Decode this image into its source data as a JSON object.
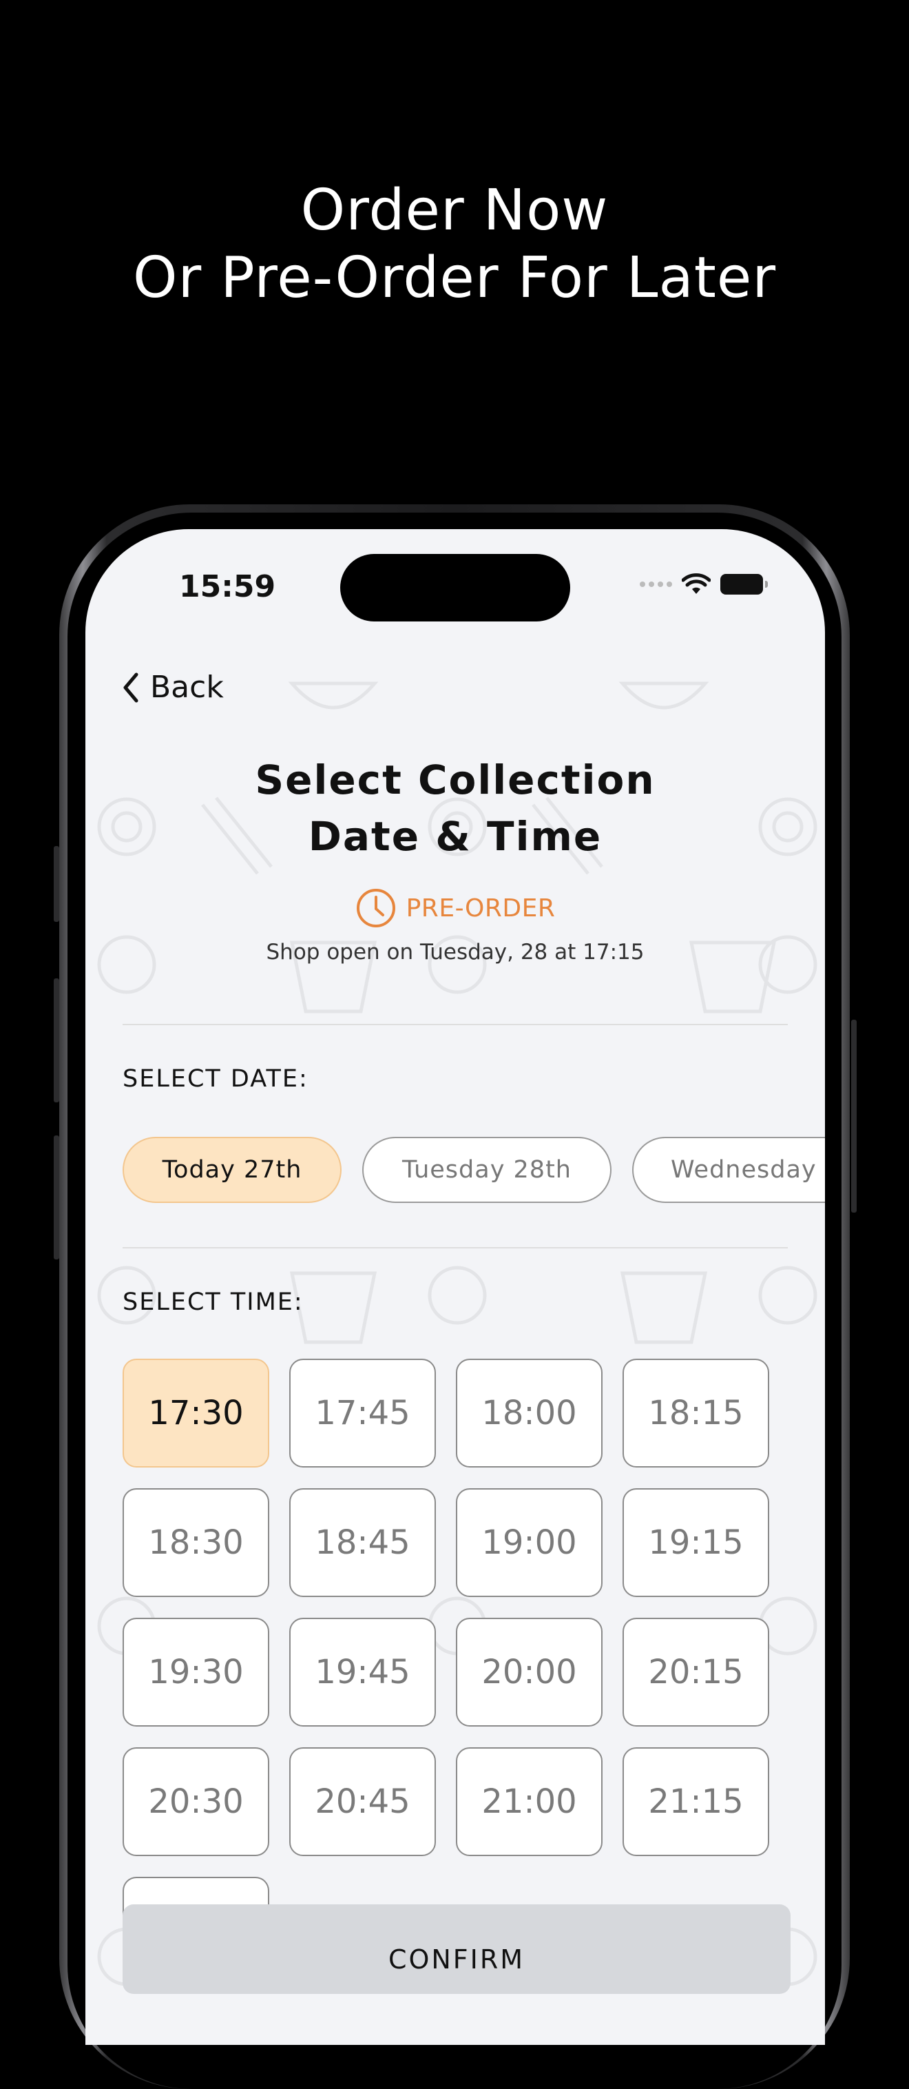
{
  "promo": {
    "line1": "Order Now",
    "line2": "Or Pre-Order For Later"
  },
  "status_bar": {
    "time": "15:59"
  },
  "nav": {
    "back_label": "Back"
  },
  "header": {
    "title_line1": "Select Collection",
    "title_line2": "Date & Time",
    "badge": "PRE-ORDER",
    "shop_open_text": "Shop open on Tuesday, 28 at 17:15"
  },
  "date_section": {
    "label": "SELECT DATE:",
    "options": [
      "Today 27th",
      "Tuesday 28th",
      "Wednesday"
    ],
    "selected": "Today 27th"
  },
  "time_section": {
    "label": "SELECT TIME:",
    "slots": [
      "17:30",
      "17:45",
      "18:00",
      "18:15",
      "18:30",
      "18:45",
      "19:00",
      "19:15",
      "19:30",
      "19:45",
      "20:00",
      "20:15",
      "20:30",
      "20:45",
      "21:00",
      "21:15"
    ],
    "selected": "17:30"
  },
  "confirm_label": "CONFIRM",
  "colors": {
    "accent": "#e7863d",
    "selected_fill": "#fde4c2",
    "background": "#f3f4f7"
  }
}
